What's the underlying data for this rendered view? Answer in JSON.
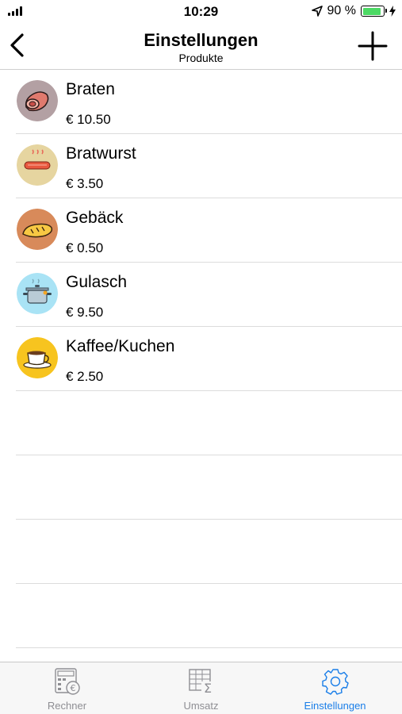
{
  "status_bar": {
    "time": "10:29",
    "battery_text": "90 %",
    "battery_level": 0.9
  },
  "nav": {
    "title": "Einstellungen",
    "subtitle": "Produkte",
    "back_icon": "chevron-left-icon",
    "add_icon": "plus-icon"
  },
  "products": [
    {
      "name": "Braten",
      "price": "€ 10.50",
      "icon": "roast-icon",
      "icon_bg": "#b3a0a3"
    },
    {
      "name": "Bratwurst",
      "price": "€ 3.50",
      "icon": "sausage-icon",
      "icon_bg": "#e6d5a0"
    },
    {
      "name": "Gebäck",
      "price": "€ 0.50",
      "icon": "bread-icon",
      "icon_bg": "#d88a5a"
    },
    {
      "name": "Gulasch",
      "price": "€ 9.50",
      "icon": "pot-icon",
      "icon_bg": "#a9e3f5"
    },
    {
      "name": "Kaffee/Kuchen",
      "price": "€ 2.50",
      "icon": "coffee-icon",
      "icon_bg": "#f7c41f"
    }
  ],
  "tabs": [
    {
      "label": "Rechner",
      "icon": "calculator-icon",
      "active": false
    },
    {
      "label": "Umsatz",
      "icon": "spreadsheet-icon",
      "active": false
    },
    {
      "label": "Einstellungen",
      "icon": "gear-icon",
      "active": true
    }
  ],
  "colors": {
    "accent": "#1a7ee8",
    "inactive": "#8e8e93",
    "battery": "#4cd964"
  }
}
